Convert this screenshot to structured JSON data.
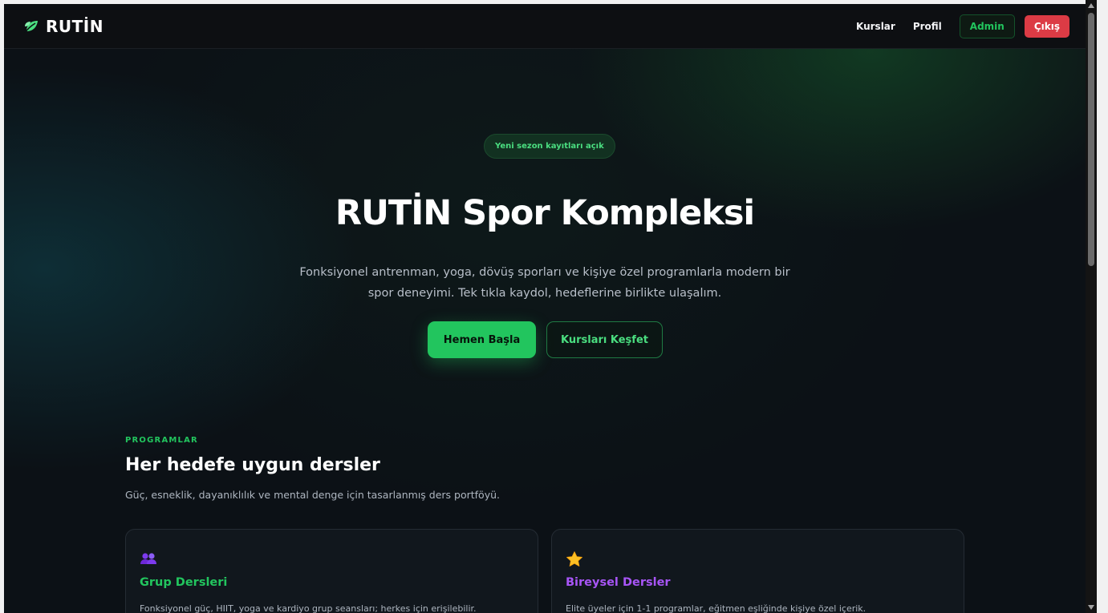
{
  "nav": {
    "brand": "RUTİN",
    "links": [
      "Kurslar",
      "Profil"
    ],
    "admin_label": "Admin",
    "exit_label": "Çıkış"
  },
  "hero": {
    "badge": "Yeni sezon kayıtları açık",
    "title": "RUTİN Spor Kompleksi",
    "subtitle": "Fonksiyonel antrenman, yoga, dövüş sporları ve kişiye özel programlarla modern bir spor deneyimi. Tek tıkla kaydol, hedeflerine birlikte ulaşalım.",
    "primary_cta": "Hemen Başla",
    "secondary_cta": "Kursları Keşfet"
  },
  "programs": {
    "eyebrow": "PROGRAMLAR",
    "title": "Her hedefe uygun dersler",
    "subtitle": "Güç, esneklik, dayanıklılık ve mental denge için tasarlanmış ders portföyü.",
    "cards": [
      {
        "icon": "people-icon",
        "title": "Grup Dersleri",
        "description": "Fonksiyonel güç, HIIT, yoga ve kardiyo grup seansları; herkes için erişilebilir."
      },
      {
        "icon": "star-icon",
        "title": "Bireysel Dersler",
        "description": "Elite üyeler için 1-1 programlar, eğitmen eşliğinde kişiye özel içerik."
      }
    ]
  },
  "colors": {
    "accent": "#22c55e",
    "danger": "#dc3b45",
    "purple": "#a855f7"
  }
}
